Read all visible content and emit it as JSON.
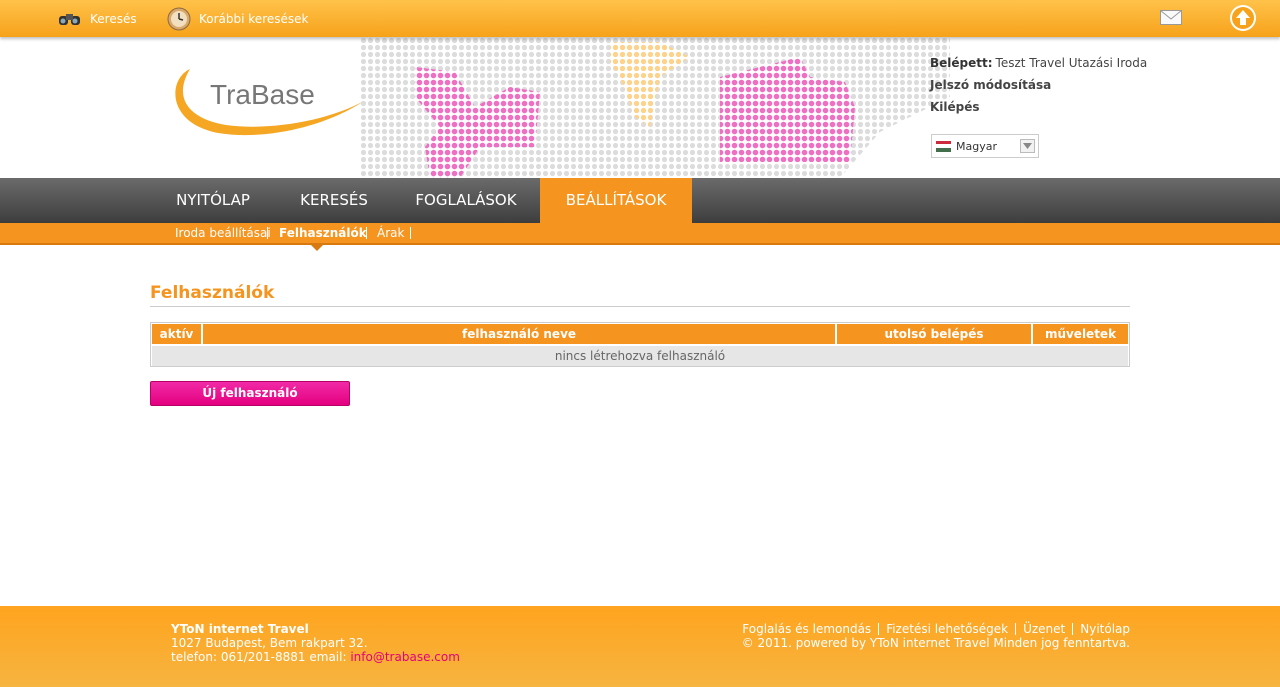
{
  "topbar": {
    "search_label": "Keresés",
    "history_label": "Korábbi keresések",
    "icons": [
      "binoculars-icon",
      "clock-icon",
      "mail-icon",
      "arrow-up-icon"
    ]
  },
  "header": {
    "logo_text": "TraBase",
    "logged_in_label": "Belépett:",
    "logged_in_name": "Teszt Travel Utazási Iroda",
    "change_password": "Jelszó módosítása",
    "logout": "Kilépés",
    "language": "Magyar"
  },
  "nav": {
    "items": [
      "NYITÓLAP",
      "KERESÉS",
      "FOGLALÁSOK",
      "BEÁLLÍTÁSOK"
    ],
    "active": "BEÁLLÍTÁSOK"
  },
  "subnav": {
    "items": [
      "Iroda beállításai",
      "Felhasználók",
      "Árak"
    ],
    "active": "Felhasználók"
  },
  "main": {
    "title": "Felhasználók",
    "table": {
      "columns": [
        "aktív",
        "felhasználó neve",
        "utolsó belépés",
        "műveletek"
      ],
      "empty_text": "nincs létrehozva felhasználó"
    },
    "new_user_button": "Új felhasználó"
  },
  "footer": {
    "company": "YToN internet Travel",
    "address": "1027 Budapest, Bem rakpart 32.",
    "phone_line": "telefon: 061/201-8881 email:",
    "email": "info@trabase.com",
    "links": [
      "Foglalás és lemondás",
      "Fizetési lehetőségek",
      "Üzenet",
      "Nyitólap"
    ],
    "copyright": "© 2011. powered by YToN internet Travel Minden jog fenntartva."
  },
  "colors": {
    "orange": "#f5941f",
    "magenta": "#e4007f",
    "nav_dark": "#4a4a4a"
  }
}
